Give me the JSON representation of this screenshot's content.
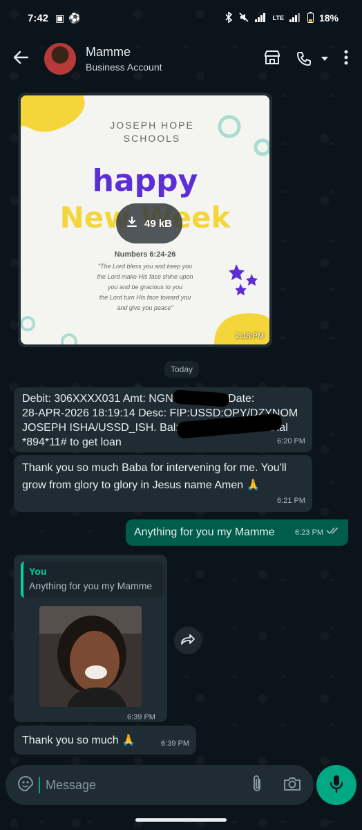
{
  "status_bar": {
    "time": "7:42",
    "battery": "18%",
    "network": "LTE"
  },
  "header": {
    "contact_name": "Mamme",
    "subtitle": "Business Account"
  },
  "messages": {
    "image1": {
      "download_size": "49 kB",
      "time": "2:18 PM",
      "poster": {
        "school": "JOSEPH HOPE\nSCHOOLS",
        "headline1": "Happy",
        "headline2": "New Week",
        "verse_ref": "Numbers 6:24-26",
        "verse_text": "\"The Lord bless you and keep you\nthe Lord make His face shine upon\nyou and be gracious to you\nthe Lord turn His face toward you\nand give you peace\""
      }
    },
    "date_divider": "Today",
    "debit": {
      "line1": "Debit: 306XXXX031 Amt: NGN",
      "line1b": "0 Date:",
      "line2": "28-APR-2026 18:19:14 Desc: FIP:USSD:OPY/DZYNOM",
      "line3": "JOSEPH ISHA/USSD_ISH. Bal: NGN",
      "line3b": "R. Dial",
      "line4": "*894*11# to get loan",
      "time": "6:20 PM"
    },
    "thanks1": {
      "text": "Thank you so much Baba for intervening for me. You'll grow from glory to glory in Jesus name Amen 🙏",
      "time": "6:21 PM"
    },
    "reply1": {
      "text": "Anything for you my Mamme",
      "time": "6:23 PM",
      "status": "read"
    },
    "photo_reply": {
      "quoted_author": "You",
      "quoted_text": "Anything for you my Mamme",
      "time": "6:39 PM"
    },
    "thanks2": {
      "text": "Thank you so much 🙏",
      "time": "6:39 PM"
    }
  },
  "composer": {
    "placeholder": "Message"
  },
  "colors": {
    "background": "#0b141a",
    "incoming_bubble": "#202c33",
    "outgoing_bubble": "#005c4b",
    "accent": "#00a884"
  },
  "icons": [
    "back-arrow-icon",
    "store-icon",
    "phone-icon",
    "chevron-down-icon",
    "more-vertical-icon",
    "download-icon",
    "forward-icon",
    "sticker-icon",
    "attach-icon",
    "camera-icon",
    "mic-icon",
    "double-check-icon"
  ]
}
